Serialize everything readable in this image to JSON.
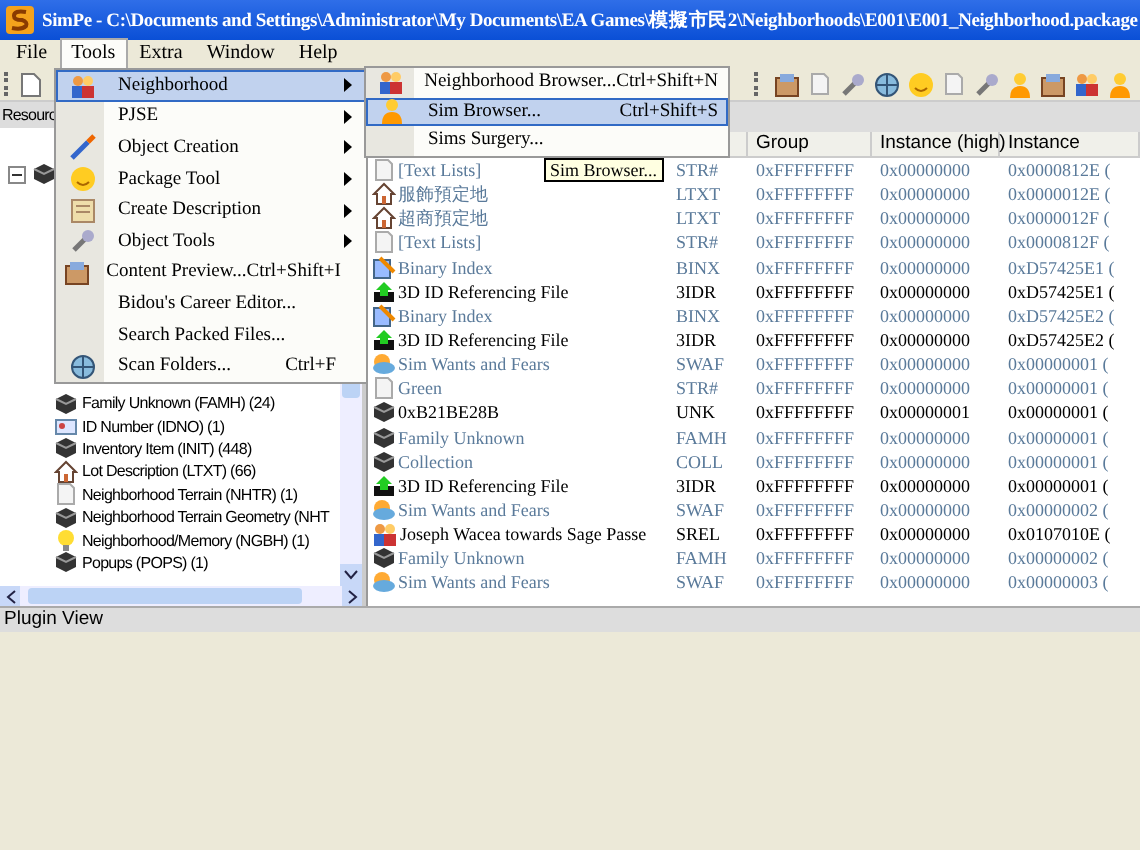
{
  "window": {
    "title": "SimPe - C:\\Documents and Settings\\Administrator\\My Documents\\EA Games\\模擬市民2\\Neighborhoods\\E001\\E001_Neighborhood.package"
  },
  "menubar": [
    {
      "label": "File",
      "selected": false
    },
    {
      "label": "Tools",
      "selected": true
    },
    {
      "label": "Extra",
      "selected": false
    },
    {
      "label": "Window",
      "selected": false
    },
    {
      "label": "Help",
      "selected": false
    }
  ],
  "resource_panel": {
    "title": "Resourc"
  },
  "tree": {
    "expanded": true,
    "children": [
      {
        "label": "Family Unknown (FAMH) (24)",
        "kind": "cube"
      },
      {
        "label": "ID Number (IDNO) (1)",
        "kind": "id"
      },
      {
        "label": "Inventory Item (INIT) (448)",
        "kind": "cube"
      },
      {
        "label": "Lot Description (LTXT) (66)",
        "kind": "house"
      },
      {
        "label": "Neighborhood Terrain (NHTR) (1)",
        "kind": "page"
      },
      {
        "label": "Neighborhood Terrain Geometry (NHT",
        "kind": "cube"
      },
      {
        "label": "Neighborhood/Memory (NGBH) (1)",
        "kind": "bulb"
      },
      {
        "label": "Popups (POPS) (1)",
        "kind": "cube"
      }
    ]
  },
  "table": {
    "columns": [
      "Group",
      "Instance (high)",
      "Instance"
    ],
    "rows": [
      {
        "kind": "page",
        "name": "[Text Lists]",
        "type": "STR#",
        "group": "0xFFFFFFFF",
        "instance_high": "0x00000000",
        "instance": "0x0000812E (",
        "faded": true
      },
      {
        "kind": "house",
        "name": "服飾預定地",
        "type": "LTXT",
        "group": "0xFFFFFFFF",
        "instance_high": "0x00000000",
        "instance": "0x0000012E (",
        "faded": true
      },
      {
        "kind": "house",
        "name": "超商預定地",
        "type": "LTXT",
        "group": "0xFFFFFFFF",
        "instance_high": "0x00000000",
        "instance": "0x0000012F (",
        "faded": true
      },
      {
        "kind": "page",
        "name": "[Text Lists]",
        "type": "STR#",
        "group": "0xFFFFFFFF",
        "instance_high": "0x00000000",
        "instance": "0x0000812F (",
        "faded": true
      },
      {
        "kind": "binx",
        "name": "Binary Index",
        "type": "BINX",
        "group": "0xFFFFFFFF",
        "instance_high": "0x00000000",
        "instance": "0xD57425E1 (",
        "faded": true
      },
      {
        "kind": "arrow",
        "name": "3D ID Referencing File",
        "type": "3IDR",
        "group": "0xFFFFFFFF",
        "instance_high": "0x00000000",
        "instance": "0xD57425E1 (",
        "faded": false
      },
      {
        "kind": "binx",
        "name": "Binary Index",
        "type": "BINX",
        "group": "0xFFFFFFFF",
        "instance_high": "0x00000000",
        "instance": "0xD57425E2 (",
        "faded": true
      },
      {
        "kind": "arrow",
        "name": "3D ID Referencing File",
        "type": "3IDR",
        "group": "0xFFFFFFFF",
        "instance_high": "0x00000000",
        "instance": "0xD57425E2 (",
        "faded": false
      },
      {
        "kind": "swaf",
        "name": "Sim Wants and Fears",
        "type": "SWAF",
        "group": "0xFFFFFFFF",
        "instance_high": "0x00000000",
        "instance": "0x00000001 (",
        "faded": true
      },
      {
        "kind": "page",
        "name": "Green",
        "type": "STR#",
        "group": "0xFFFFFFFF",
        "instance_high": "0x00000000",
        "instance": "0x00000001 (",
        "faded": true
      },
      {
        "kind": "cube",
        "name": "0xB21BE28B",
        "type": "UNK",
        "group": "0xFFFFFFFF",
        "instance_high": "0x00000001",
        "instance": "0x00000001 (",
        "faded": false
      },
      {
        "kind": "cube",
        "name": "Family Unknown",
        "type": "FAMH",
        "group": "0xFFFFFFFF",
        "instance_high": "0x00000000",
        "instance": "0x00000001 (",
        "faded": true
      },
      {
        "kind": "cube",
        "name": "Collection",
        "type": "COLL",
        "group": "0xFFFFFFFF",
        "instance_high": "0x00000000",
        "instance": "0x00000001 (",
        "faded": true
      },
      {
        "kind": "arrow",
        "name": "3D ID Referencing File",
        "type": "3IDR",
        "group": "0xFFFFFFFF",
        "instance_high": "0x00000000",
        "instance": "0x00000001 (",
        "faded": false
      },
      {
        "kind": "swaf",
        "name": "Sim Wants and Fears",
        "type": "SWAF",
        "group": "0xFFFFFFFF",
        "instance_high": "0x00000000",
        "instance": "0x00000002 (",
        "faded": true
      },
      {
        "kind": "people",
        "name": "Joseph Wacea towards Sage Passe",
        "type": "SREL",
        "group": "0xFFFFFFFF",
        "instance_high": "0x00000000",
        "instance": "0x0107010E (",
        "faded": false
      },
      {
        "kind": "cube",
        "name": "Family Unknown",
        "type": "FAMH",
        "group": "0xFFFFFFFF",
        "instance_high": "0x00000000",
        "instance": "0x00000002 (",
        "faded": true
      },
      {
        "kind": "swaf",
        "name": "Sim Wants and Fears",
        "type": "SWAF",
        "group": "0xFFFFFFFF",
        "instance_high": "0x00000000",
        "instance": "0x00000003 (",
        "faded": true
      }
    ]
  },
  "plugin_view": {
    "title": "Plugin View"
  },
  "tools_menu": [
    {
      "label": "Neighborhood",
      "submenu": true,
      "selected": true,
      "kind": "people"
    },
    {
      "label": "PJSE",
      "submenu": true,
      "selected": false
    },
    {
      "label": "Object Creation",
      "submenu": true,
      "selected": false,
      "kind": "wand"
    },
    {
      "label": "Package Tool",
      "submenu": true,
      "selected": false,
      "kind": "smile"
    },
    {
      "label": "Create Description",
      "submenu": true,
      "selected": false,
      "kind": "note"
    },
    {
      "label": "Object Tools",
      "submenu": true,
      "selected": false,
      "kind": "tool"
    },
    {
      "label": "Content Preview...",
      "shortcut": "Ctrl+Shift+I",
      "submenu": false,
      "selected": false,
      "kind": "box"
    },
    {
      "label": "Bidou's Career Editor...",
      "submenu": false,
      "selected": false
    },
    {
      "label": "Search Packed Files...",
      "submenu": false,
      "selected": false
    },
    {
      "label": "Scan Folders...",
      "shortcut": "Ctrl+F",
      "submenu": false,
      "selected": false,
      "kind": "globe"
    }
  ],
  "neighborhood_submenu": [
    {
      "label": "Neighborhood Browser...",
      "shortcut": "Ctrl+Shift+N",
      "selected": false,
      "kind": "people"
    },
    {
      "label": "Sim Browser...",
      "shortcut": "Ctrl+Shift+S",
      "selected": true,
      "kind": "person"
    },
    {
      "label": "Sims Surgery...",
      "selected": false
    }
  ],
  "tooltip": {
    "text": "Sim Browser..."
  }
}
